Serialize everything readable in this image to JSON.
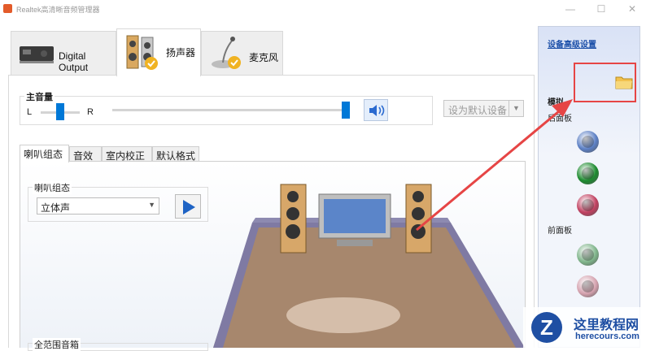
{
  "window": {
    "title": "Realtek高清晰音频管理器",
    "minimize": "—",
    "maximize": "☐",
    "close": "✕"
  },
  "device_tabs": [
    {
      "label": "Digital Output",
      "icon": "digital-output-icon"
    },
    {
      "label": "扬声器",
      "icon": "speaker-icon",
      "active": true
    },
    {
      "label": "麦克风",
      "icon": "microphone-icon"
    }
  ],
  "volume": {
    "title": "主音量",
    "left": "L",
    "right": "R",
    "balance": 0.5,
    "level": 1.0
  },
  "default_device_button": "设为默认设备",
  "sub_tabs": [
    "喇叭组态",
    "音效",
    "室内校正",
    "默认格式"
  ],
  "speaker_config": {
    "group_title": "喇叭组态",
    "selected": "立体声",
    "fullrange_title": "全范围音箱"
  },
  "side": {
    "advanced_link": "设备高级设置",
    "analog_label": "模拟",
    "rear_label": "后面板",
    "front_label": "前面板",
    "rear_jack_colors": [
      "#5b7fc4",
      "#1c8a2e",
      "#c04060"
    ],
    "front_jack_colors": [
      "#7fb48a",
      "#d4a1ae"
    ]
  },
  "watermark": {
    "name": "这里教程网",
    "url": "herecours.com",
    "logo": "Z"
  },
  "colors": {
    "accent": "#0078d7",
    "highlight": "#e64545",
    "link": "#1a4ea8"
  }
}
